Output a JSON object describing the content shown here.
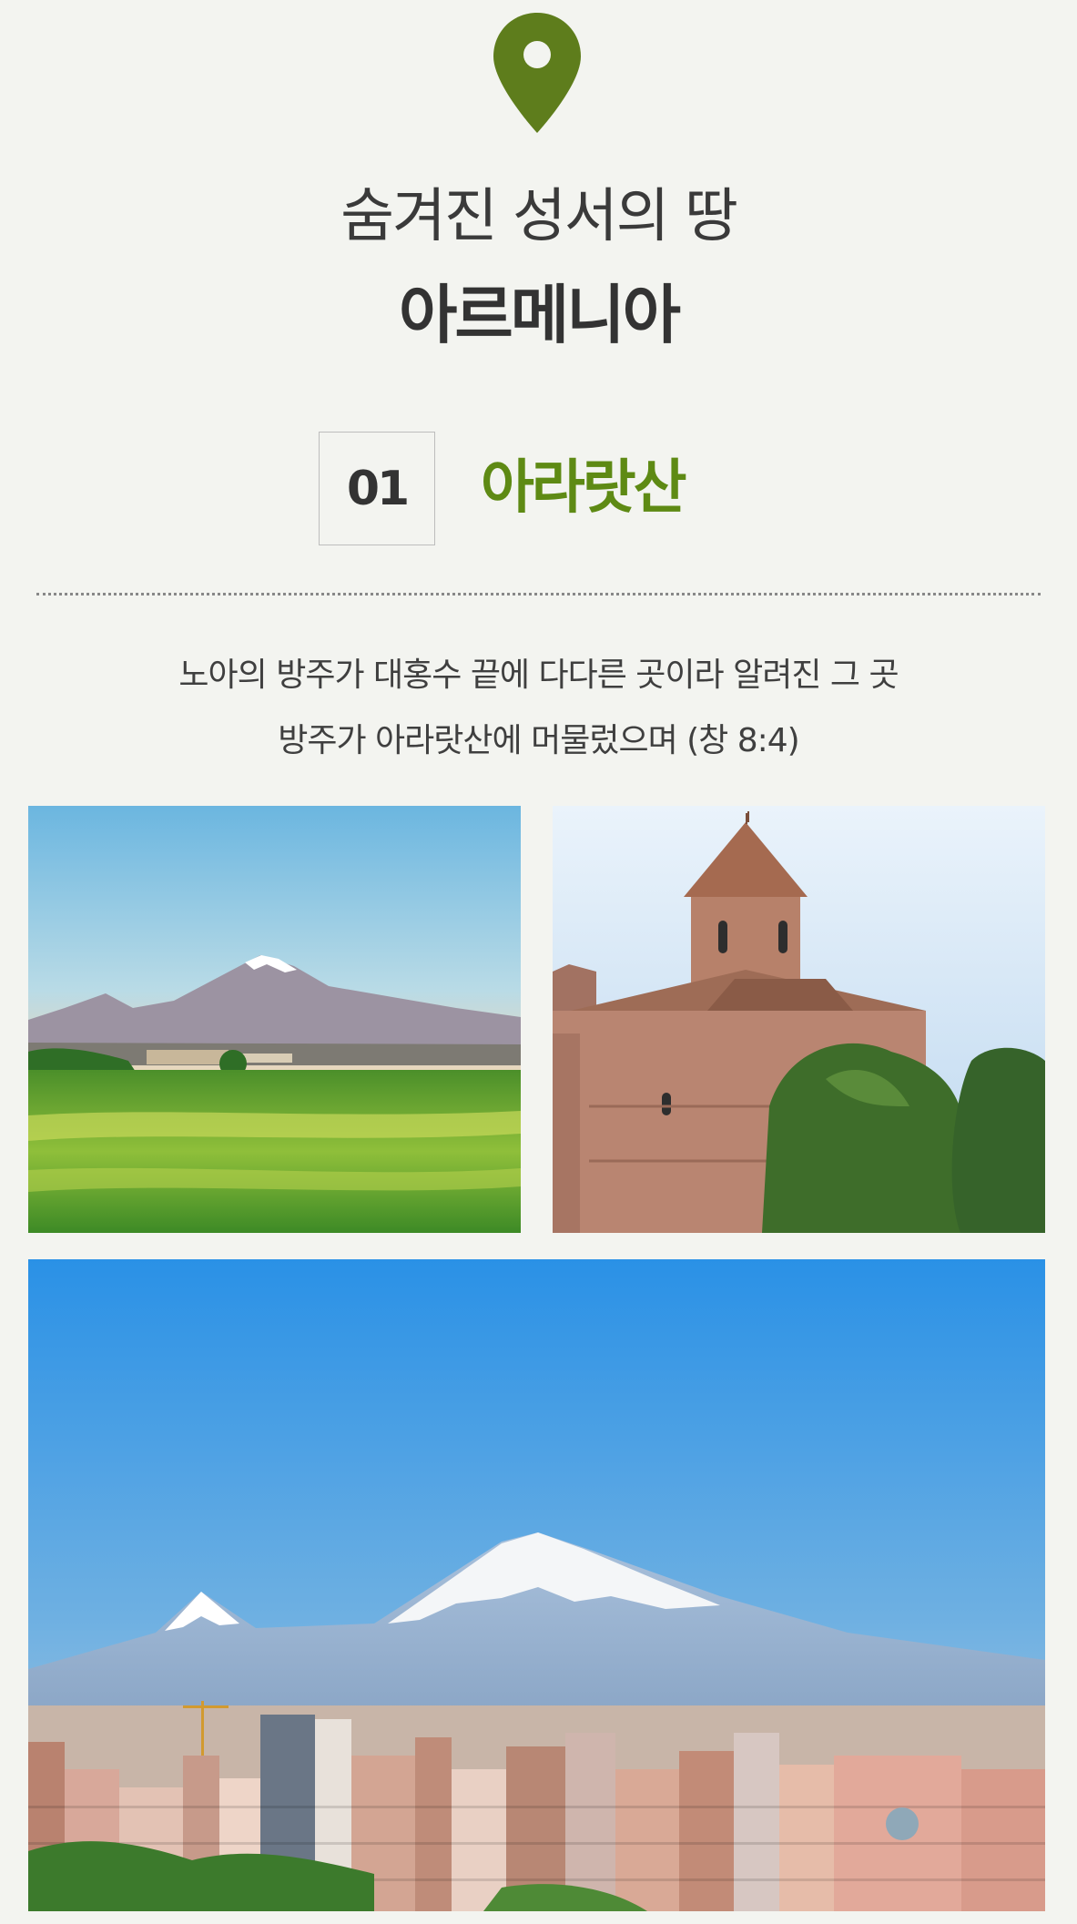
{
  "header": {
    "pin_icon": "location-pin-icon",
    "pin_color": "#5e7d1c",
    "title_line1": "숨겨진 성서의 땅",
    "title_line2": "아르메니아"
  },
  "section": {
    "number": "01",
    "title": "아라랏산",
    "accent_color": "#5e8a14"
  },
  "description": {
    "line1": "노아의 방주가 대홍수 끝에 다다른 곳이라 알려진 그 곳",
    "line2": "방주가 아라랏산에 머물렀으며 (창 8:4)"
  },
  "photos": [
    {
      "subject": "mount-ararat-fields-photo"
    },
    {
      "subject": "armenian-church-photo"
    },
    {
      "subject": "yerevan-city-ararat-photo"
    }
  ]
}
